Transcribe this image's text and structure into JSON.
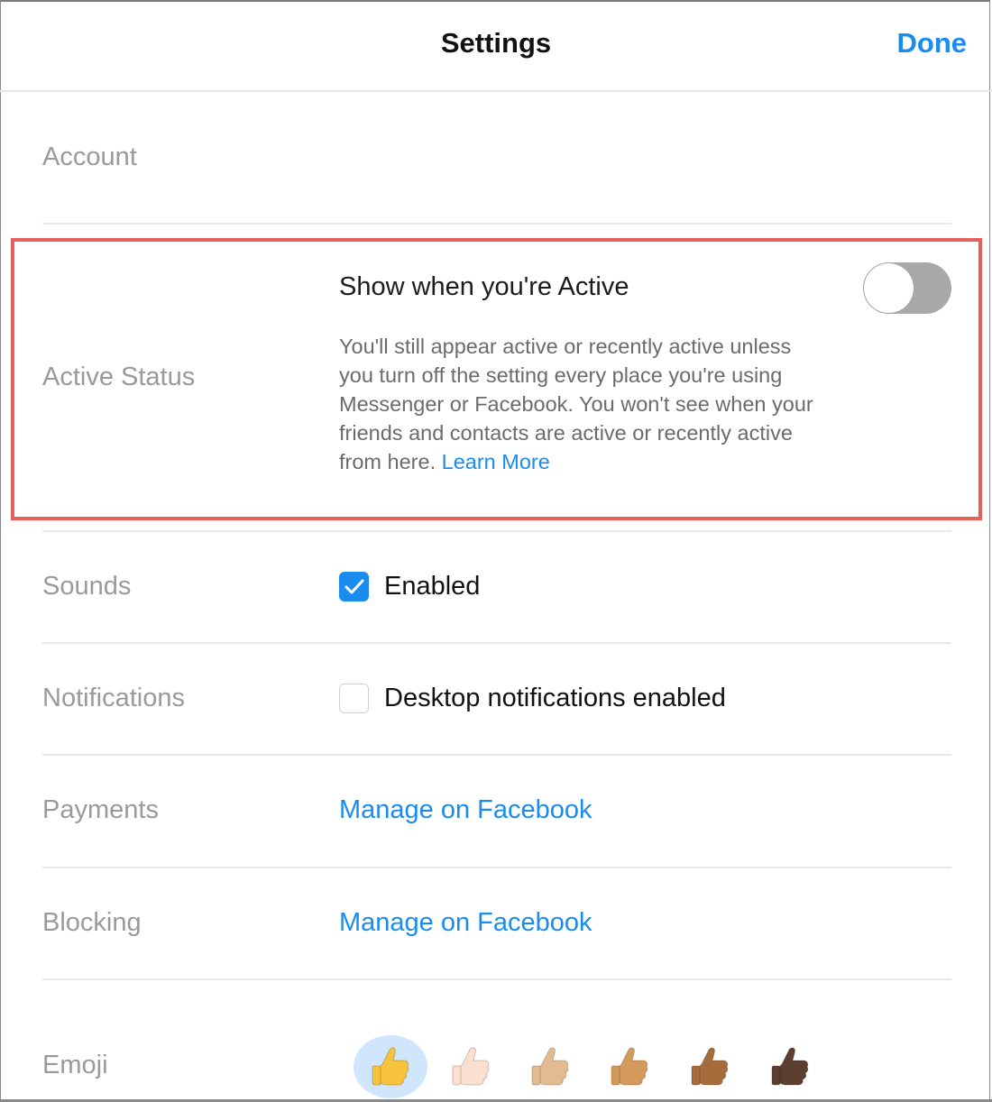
{
  "header": {
    "title": "Settings",
    "done_label": "Done"
  },
  "account": {
    "label": "Account"
  },
  "active_status": {
    "label": "Active Status",
    "title": "Show when you're Active",
    "description": "You'll still appear active or recently active unless you turn off the setting every place you're using Messenger or Facebook. You won't see when your friends and contacts are active or recently active from here.",
    "link_label": "Learn More",
    "toggle_on": false,
    "highlight_color": "#e8605c"
  },
  "sounds": {
    "label": "Sounds",
    "option_label": "Enabled",
    "checked": true
  },
  "notifications": {
    "label": "Notifications",
    "option_label": "Desktop notifications enabled",
    "checked": false
  },
  "payments": {
    "label": "Payments",
    "link_label": "Manage on Facebook"
  },
  "blocking": {
    "label": "Blocking",
    "link_label": "Manage on Facebook"
  },
  "emoji": {
    "label": "Emoji",
    "options": [
      {
        "name": "thumbs-up-default",
        "tone": "#f7c23c",
        "selected": true
      },
      {
        "name": "thumbs-up-light",
        "tone": "#fbe0cf",
        "selected": false
      },
      {
        "name": "thumbs-up-medium-light",
        "tone": "#e3bb93",
        "selected": false
      },
      {
        "name": "thumbs-up-medium",
        "tone": "#d39a5c",
        "selected": false
      },
      {
        "name": "thumbs-up-medium-dark",
        "tone": "#a56b3a",
        "selected": false
      },
      {
        "name": "thumbs-up-dark",
        "tone": "#5c3e30",
        "selected": false
      }
    ]
  },
  "colors": {
    "accent": "#1a8cf0",
    "label_gray": "#9a9a9a"
  }
}
